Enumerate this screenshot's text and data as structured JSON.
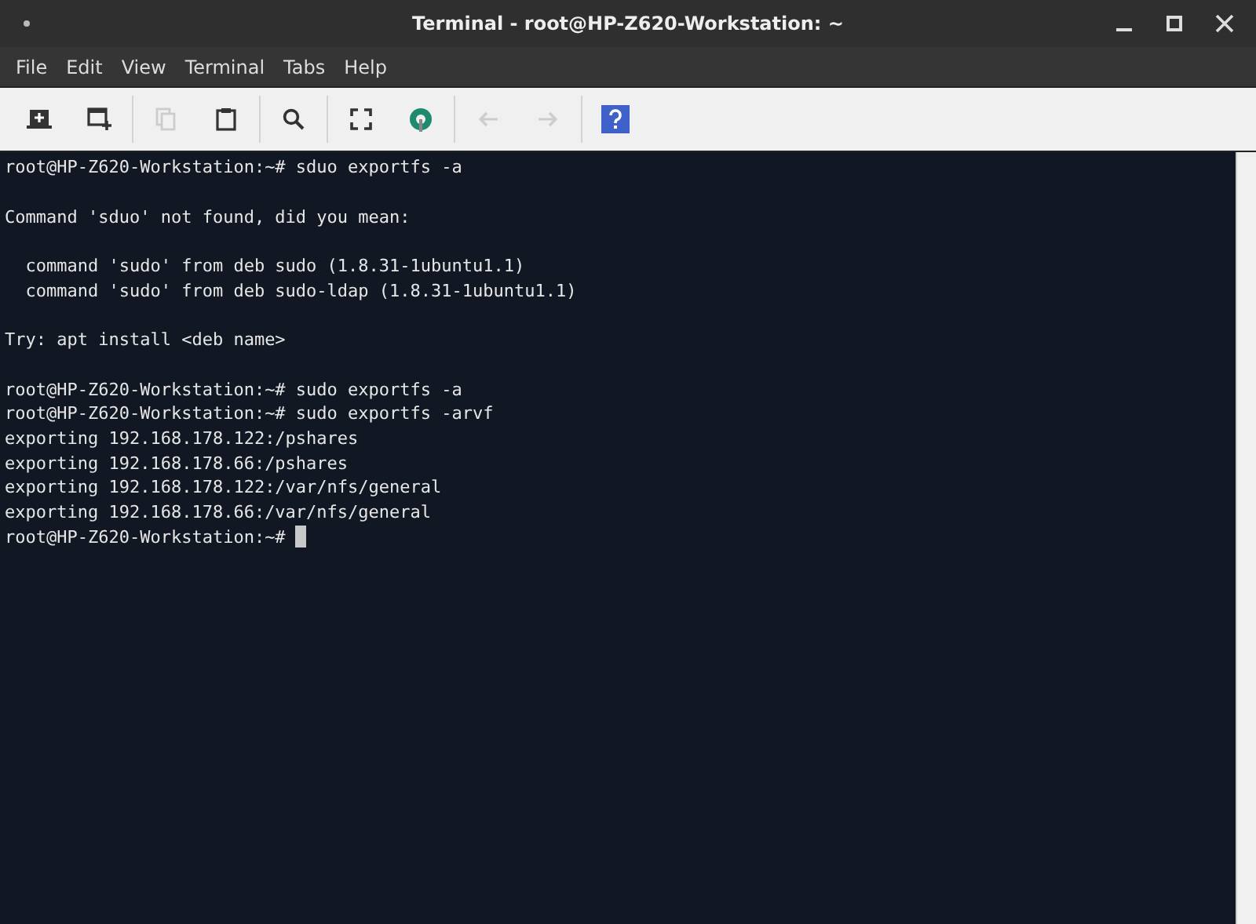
{
  "window": {
    "title": "Terminal - root@HP-Z620-Workstation: ~"
  },
  "menu": [
    "File",
    "Edit",
    "View",
    "Terminal",
    "Tabs",
    "Help"
  ],
  "toolbar_groups": [
    [
      {
        "kind": "new-tab",
        "disabled": false
      },
      {
        "kind": "new-window",
        "disabled": false
      }
    ],
    [
      {
        "kind": "copy",
        "disabled": true
      },
      {
        "kind": "paste",
        "disabled": false
      }
    ],
    [
      {
        "kind": "search",
        "disabled": false
      }
    ],
    [
      {
        "kind": "fullscreen",
        "disabled": false
      },
      {
        "kind": "preferences",
        "disabled": false
      }
    ],
    [
      {
        "kind": "back",
        "disabled": true
      },
      {
        "kind": "forward",
        "disabled": true
      }
    ],
    [
      {
        "kind": "help",
        "disabled": false
      }
    ]
  ],
  "terminal": {
    "cursor_visible": true,
    "blocks": [
      [
        "root@HP-Z620-Workstation:~# sduo exportfs -a"
      ],
      [
        "Command 'sduo' not found, did you mean:"
      ],
      [
        "  command 'sudo' from deb sudo (1.8.31-1ubuntu1.1)",
        "  command 'sudo' from deb sudo-ldap (1.8.31-1ubuntu1.1)"
      ],
      [
        "Try: apt install <deb name>"
      ],
      [
        "root@HP-Z620-Workstation:~# sudo exportfs -a",
        "root@HP-Z620-Workstation:~# sudo exportfs -arvf",
        "exporting 192.168.178.122:/pshares",
        "exporting 192.168.178.66:/pshares",
        "exporting 192.168.178.122:/var/nfs/general",
        "exporting 192.168.178.66:/var/nfs/general",
        "root@HP-Z620-Workstation:~# "
      ]
    ]
  }
}
